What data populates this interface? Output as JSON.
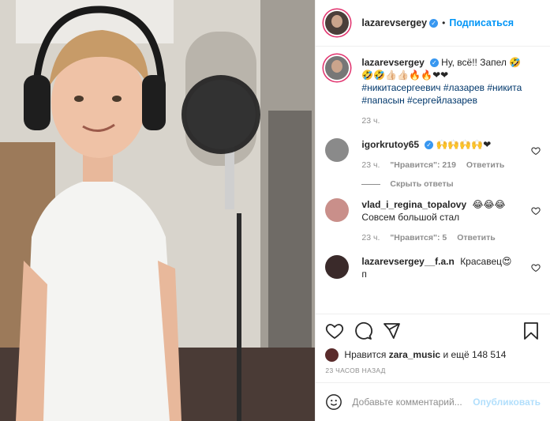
{
  "header": {
    "username": "lazarevsergey",
    "dot": "•",
    "follow": "Подписаться"
  },
  "caption": {
    "username": "lazarevsergey",
    "text": "Ну, всё!! Запел 🤣",
    "emoji_line": "🤣🤣👍🏻👍🏻🔥🔥❤❤",
    "hashtags": "#никитасергеевич #лазарев #никита #папасын #сергейлазарев",
    "time": "23 ч."
  },
  "comments": [
    {
      "username": "igorkrutoy65",
      "verified": true,
      "text": "🙌🙌🙌🙌❤",
      "time": "23 ч.",
      "likes": "\"Нравится\": 219",
      "reply": "Ответить"
    },
    {
      "username": "vlad_i_regina_topalovy",
      "verified": false,
      "text": "😂😂😂",
      "subtext": "Совсем большой стал",
      "time": "23 ч.",
      "likes": "\"Нравится\": 5",
      "reply": "Ответить"
    },
    {
      "username": "lazarevsergey__f.a.n",
      "verified": false,
      "text": "Красавец😍",
      "subtext": "п"
    }
  ],
  "hide_replies": "Скрыть ответы",
  "likes": {
    "prefix": "Нравится",
    "user": "zara_music",
    "suffix": "и ещё 148 514"
  },
  "timestamp": "23 ЧАСОВ НАЗАД",
  "add_comment": {
    "placeholder": "Добавьте комментарий...",
    "publish": "Опубликовать"
  },
  "colors": {
    "link": "#0095f6",
    "verified": "#3897f0",
    "tag": "#00376b",
    "muted": "#8e8e8e"
  }
}
